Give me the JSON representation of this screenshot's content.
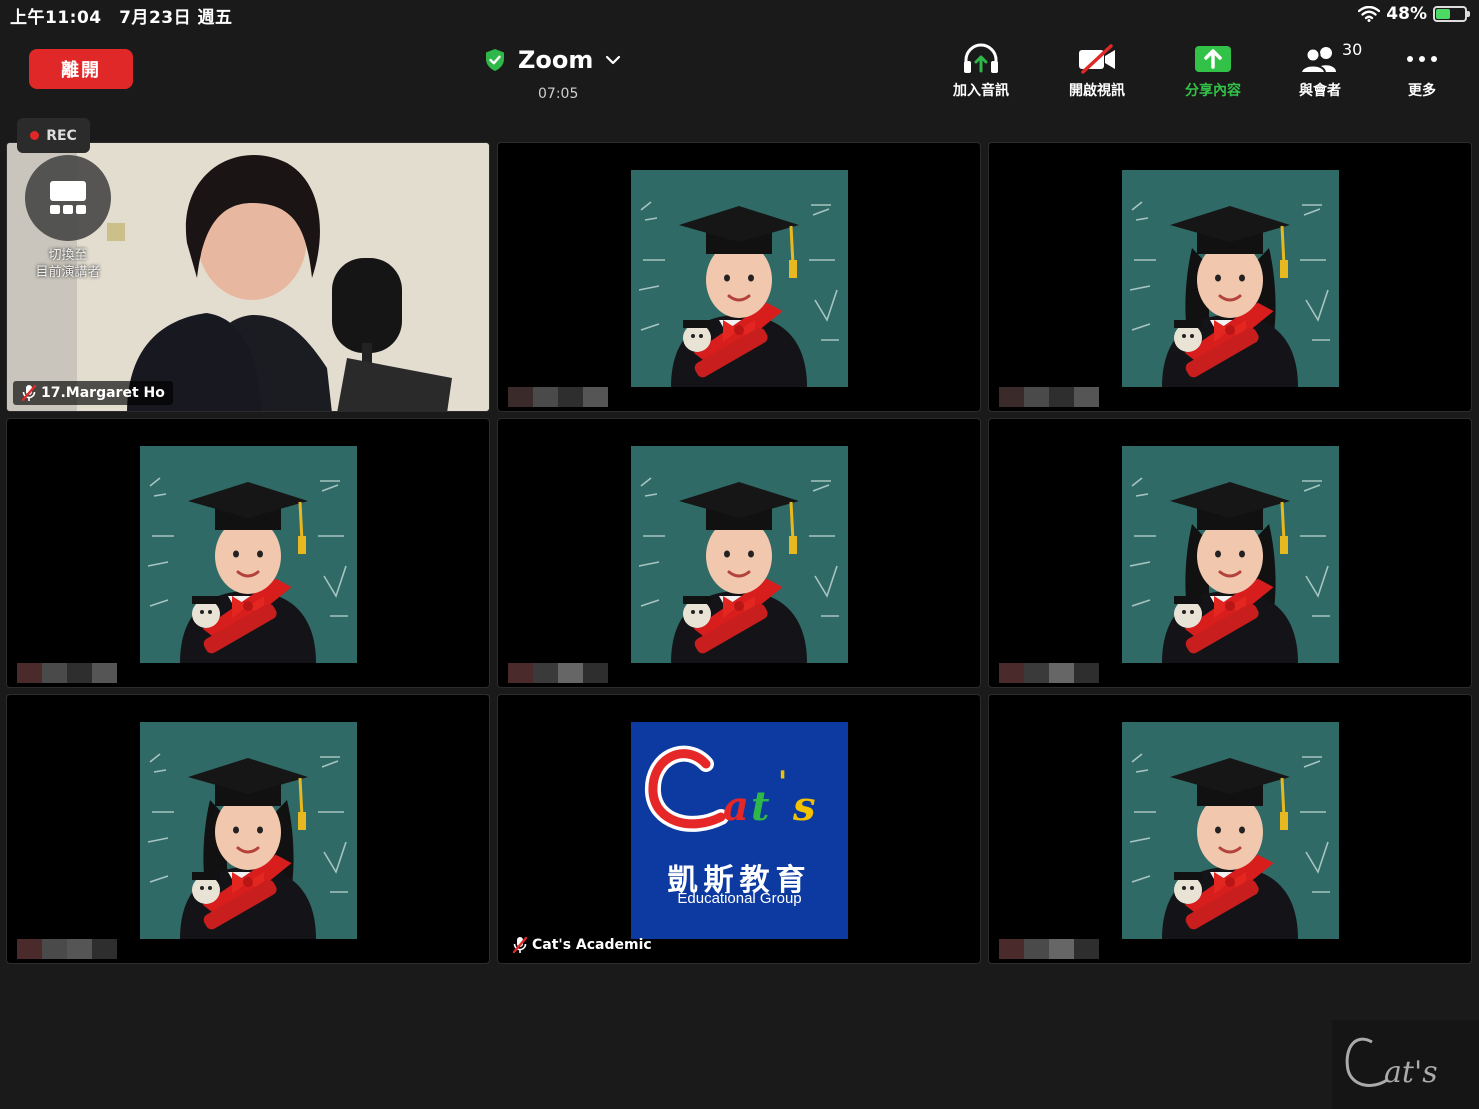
{
  "status_bar": {
    "time": "上午11:04　7月23日 週五",
    "battery": "48%",
    "battery_level": 0.48
  },
  "top_bar": {
    "leave_label": "離開",
    "meeting_name": "Zoom",
    "timer": "07:05",
    "participant_count": "30",
    "toolbar": [
      {
        "id": "audio",
        "label": "加入音訊",
        "icon": "headphones-icon"
      },
      {
        "id": "video",
        "label": "開啟視訊",
        "icon": "video-off-icon"
      },
      {
        "id": "share",
        "label": "分享內容",
        "icon": "share-screen-icon"
      },
      {
        "id": "participants",
        "label": "與會者",
        "icon": "participants-icon"
      },
      {
        "id": "more",
        "label": "更多",
        "icon": "more-icon"
      }
    ]
  },
  "recording": {
    "label": "REC"
  },
  "switch_speaker": {
    "label_line1": "切換至",
    "label_line2": "目前演講者"
  },
  "tiles": [
    {
      "name": "17.Margaret Ho",
      "muted": true,
      "type": "video"
    },
    {
      "name": "",
      "type": "grad-boy"
    },
    {
      "name": "",
      "type": "grad-girl"
    },
    {
      "name": "",
      "type": "grad-boy"
    },
    {
      "name": "",
      "type": "grad-boy"
    },
    {
      "name": "",
      "type": "grad-girl"
    },
    {
      "name": "",
      "type": "grad-girl"
    },
    {
      "name": "Cat's Academic",
      "muted": true,
      "type": "logo"
    },
    {
      "name": "",
      "type": "grad-boy"
    }
  ],
  "logo": {
    "script": "Cat's",
    "chinese": "凱斯教育",
    "english": "Educational Group"
  },
  "watermark": {
    "text": "Cat's"
  },
  "colors": {
    "leave": "#e02828",
    "share": "#33c248",
    "shield": "#2fb84a",
    "chalkboard": "#2f6a66",
    "logo_bg": "#0d3aa1"
  }
}
